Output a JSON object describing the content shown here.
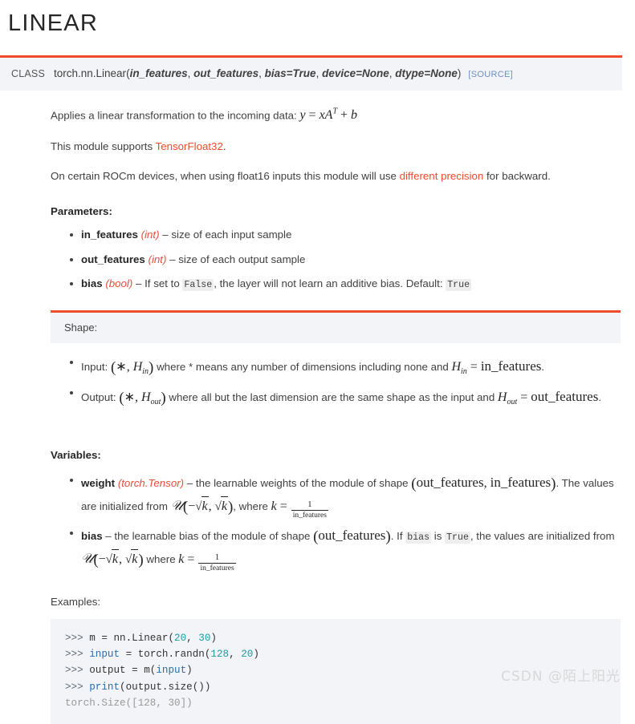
{
  "page": {
    "title": "LINEAR",
    "accent_color": "#ee4c2c",
    "panel_bg": "#f3f4f7",
    "link_color": "#ee4c2c",
    "source_link_color": "#6c8fc4"
  },
  "signature": {
    "class_label": "CLASS",
    "qualified_name": "torch.nn.Linear",
    "open_paren": "(",
    "close_paren": ")",
    "params": [
      "in_features",
      "out_features",
      "bias=True",
      "device=None",
      "dtype=None"
    ],
    "separator": ", ",
    "source_label": "[SOURCE]"
  },
  "description": {
    "line1_text": "Applies a linear transformation to the incoming data: ",
    "line1_formula_plain": "y = xA^T + b",
    "line2_prefix": "This module supports ",
    "line2_link": "TensorFloat32",
    "line2_suffix": ".",
    "line3_prefix": "On certain ROCm devices, when using float16 inputs this module will use ",
    "line3_link": "different precision",
    "line3_suffix": " for backward."
  },
  "parameters": {
    "heading": "Parameters:",
    "items": [
      {
        "name": "in_features",
        "type": "(int)",
        "dash": " – ",
        "desc": "size of each input sample"
      },
      {
        "name": "out_features",
        "type": "(int)",
        "dash": " – ",
        "desc": "size of each output sample"
      },
      {
        "name": "bias",
        "type": "(bool)",
        "dash": " – ",
        "desc_pre": "If set to ",
        "code1": "False",
        "desc_mid": ", the layer will not learn an additive bias. Default: ",
        "code2": "True"
      }
    ]
  },
  "shape": {
    "title": "Shape:",
    "input": {
      "label": "Input: ",
      "tuple_plain": "(*, H_in)",
      "mid": " where ",
      "star": "*",
      "mid2": " means any number of dimensions including none and ",
      "eq_plain": "H_in = in_features",
      "period": "."
    },
    "output": {
      "label": "Output: ",
      "tuple_plain": "(*, H_out)",
      "mid": " where all but the last dimension are the same shape as the input and ",
      "eq_plain": "H_out = out_features",
      "period": "."
    }
  },
  "variables": {
    "heading": "Variables:",
    "weight": {
      "name": "weight",
      "type": "(torch.Tensor)",
      "dash": " – ",
      "desc1": "the learnable weights of the module of shape ",
      "shape_plain": "(out_features, in_features)",
      "period1": ".",
      "desc2": "The values are initialized from ",
      "dist_plain": "U(-sqrt(k), sqrt(k))",
      "desc3": ", where ",
      "k_plain": "k = 1 / in_features",
      "k_num": "1",
      "k_den": "in_features"
    },
    "bias": {
      "name": "bias",
      "dash": " – ",
      "desc1": "the learnable bias of the module of shape ",
      "shape_plain": "(out_features)",
      "period1": ". If ",
      "code1": "bias",
      "desc_is": " is ",
      "code2": "True",
      "desc2": ", the values are initialized from ",
      "dist_plain": "U(-sqrt(k), sqrt(k))",
      "desc3": " where ",
      "k_plain": "k = 1 / in_features",
      "k_num": "1",
      "k_den": "in_features"
    }
  },
  "examples": {
    "label": "Examples:",
    "lines": [
      {
        "prompt": ">>> ",
        "segments": [
          {
            "t": "m = nn.Linear(",
            "c": "plain"
          },
          {
            "t": "20",
            "c": "num"
          },
          {
            "t": ", ",
            "c": "plain"
          },
          {
            "t": "30",
            "c": "num"
          },
          {
            "t": ")",
            "c": "plain"
          }
        ]
      },
      {
        "prompt": ">>> ",
        "segments": [
          {
            "t": "input",
            "c": "kw"
          },
          {
            "t": " = torch.randn(",
            "c": "plain"
          },
          {
            "t": "128",
            "c": "num"
          },
          {
            "t": ", ",
            "c": "plain"
          },
          {
            "t": "20",
            "c": "num"
          },
          {
            "t": ")",
            "c": "plain"
          }
        ]
      },
      {
        "prompt": ">>> ",
        "segments": [
          {
            "t": "output = m(",
            "c": "plain"
          },
          {
            "t": "input",
            "c": "kw"
          },
          {
            "t": ")",
            "c": "plain"
          }
        ]
      },
      {
        "prompt": ">>> ",
        "segments": [
          {
            "t": "print",
            "c": "kw"
          },
          {
            "t": "(output.size())",
            "c": "plain"
          }
        ]
      },
      {
        "prompt": "",
        "segments": [
          {
            "t": "torch.Size([128, 30])",
            "c": "out"
          }
        ]
      }
    ]
  },
  "watermark": {
    "text": "CSDN @陌上阳光"
  }
}
